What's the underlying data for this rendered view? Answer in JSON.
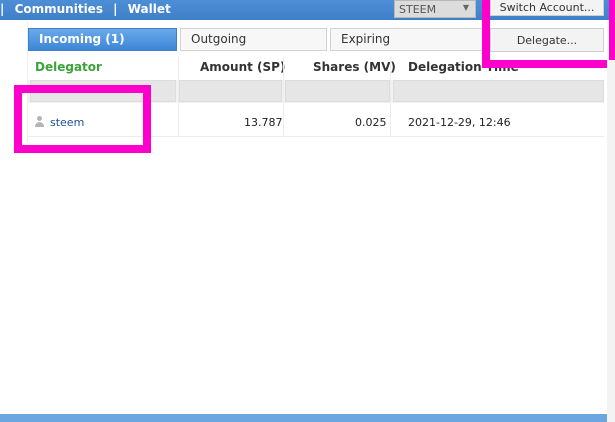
{
  "topbar": {
    "nav_items": [
      "Communities",
      "Wallet"
    ],
    "separator": "|",
    "currency": "STEEM",
    "switch_account_label": "Switch Account..."
  },
  "tabs": [
    {
      "label": "Incoming (1)",
      "active": true
    },
    {
      "label": "Outgoing",
      "active": false
    },
    {
      "label": "Expiring",
      "active": false
    }
  ],
  "delegate_label": "Delegate...",
  "table": {
    "columns": [
      "Delegator",
      "Amount (SP)",
      "Shares (MV)",
      "Delegation Time"
    ],
    "rows": [
      {
        "delegator": "steem",
        "amount": "13.787",
        "shares": "0.025",
        "time": "2021-12-29, 12:46"
      }
    ]
  },
  "colors": {
    "brand_blue": "#4d8fd6",
    "highlight": "#ff00cc",
    "delegator_header": "#3aa43a"
  },
  "icons": [
    "user-icon",
    "caret-down-icon"
  ]
}
